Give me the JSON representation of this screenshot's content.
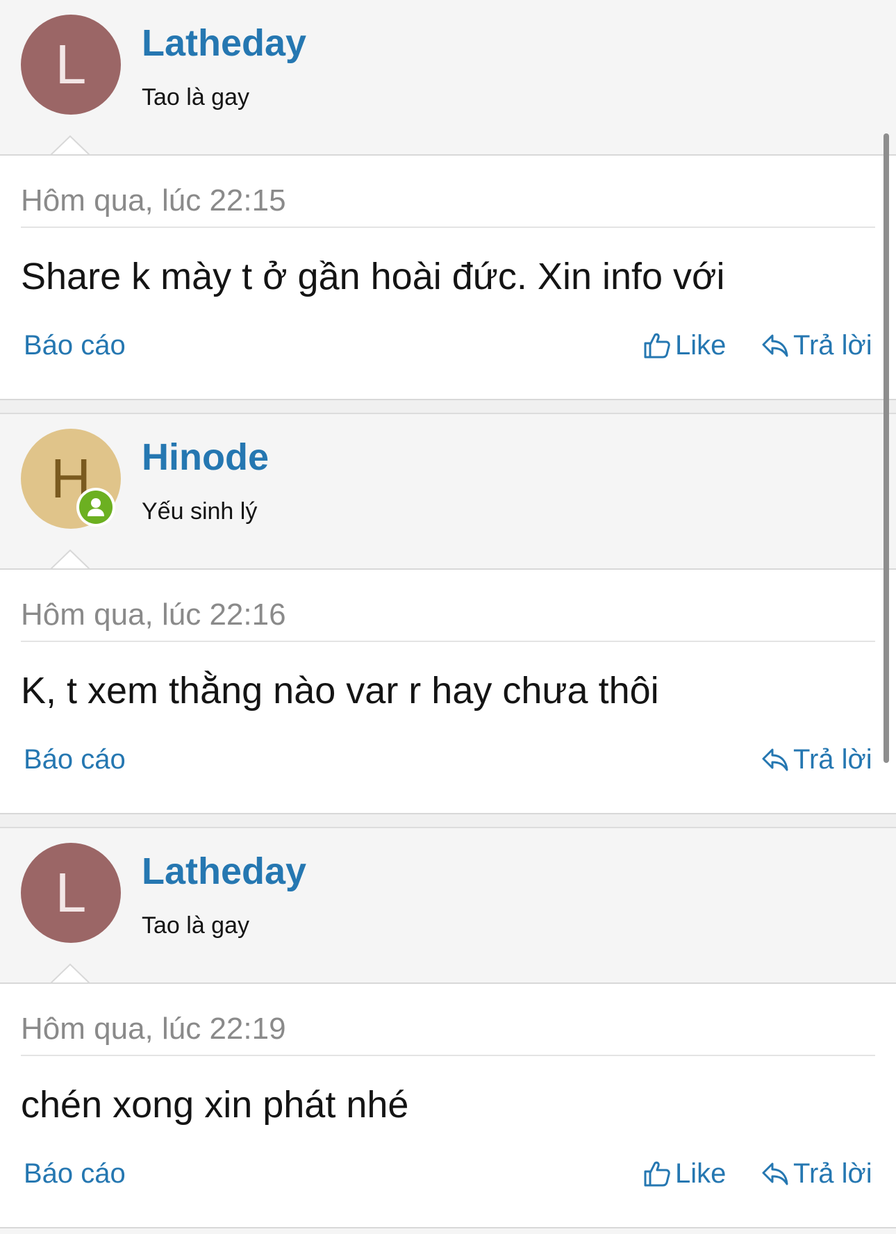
{
  "theme": {
    "link_color": "#2577b1",
    "username_color": "#2577b1",
    "scrollbar_color": "#8e8e8e",
    "online_color": "#6cb021"
  },
  "posts": [
    {
      "avatar": {
        "letter": "L",
        "bg_color": "#9b6666",
        "fg_color": "#f3e6e6",
        "online": false
      },
      "username": "Latheday",
      "user_title": "Tao là gay",
      "timestamp": "Hôm qua, lúc 22:15",
      "message": "Share k mày t ở gần hoài đức. Xin info với",
      "actions": {
        "report": "Báo cáo",
        "like": "Like",
        "reply": "Trả lời"
      },
      "show_like": true
    },
    {
      "avatar": {
        "letter": "H",
        "bg_color": "#e0c48a",
        "fg_color": "#7a5a1f",
        "online": true
      },
      "username": "Hinode",
      "user_title": "Yếu sinh lý",
      "timestamp": "Hôm qua, lúc 22:16",
      "message": "K, t xem thằng nào var r hay chưa thôi",
      "actions": {
        "report": "Báo cáo",
        "like": "",
        "reply": "Trả lời"
      },
      "show_like": false
    },
    {
      "avatar": {
        "letter": "L",
        "bg_color": "#9b6666",
        "fg_color": "#f3e6e6",
        "online": false
      },
      "username": "Latheday",
      "user_title": "Tao là gay",
      "timestamp": "Hôm qua, lúc 22:19",
      "message": "chén xong xin phát nhé",
      "actions": {
        "report": "Báo cáo",
        "like": "Like",
        "reply": "Trả lời"
      },
      "show_like": true
    }
  ],
  "icons": {
    "like": "thumbs-up-icon",
    "reply": "reply-icon",
    "online": "user-online-icon"
  }
}
